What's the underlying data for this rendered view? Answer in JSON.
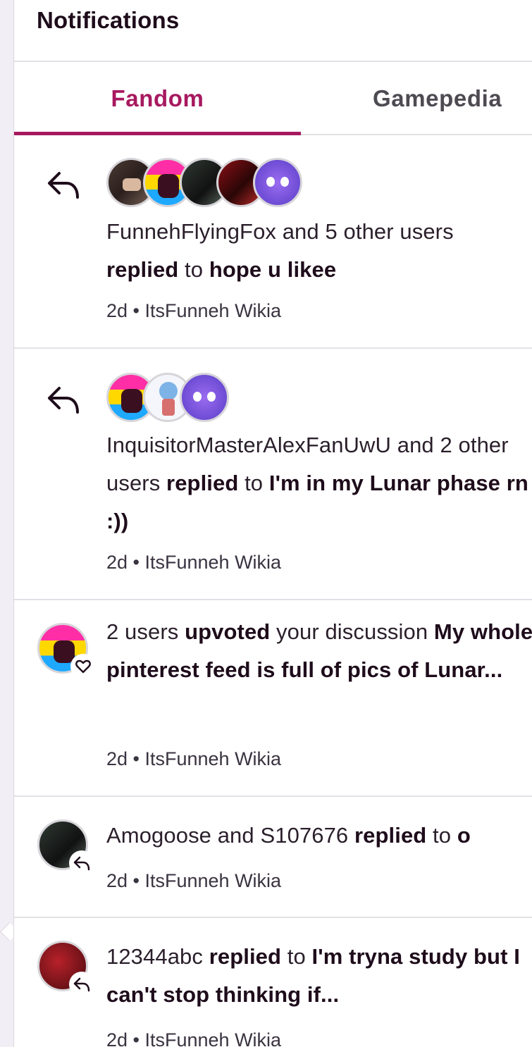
{
  "header": {
    "title": "Notifications"
  },
  "tabs": [
    {
      "label": "Fandom",
      "active": true
    },
    {
      "label": "Gamepedia",
      "active": false
    }
  ],
  "colors": {
    "accent": "#a7195f",
    "text": "#1e0c1b",
    "divider": "#e3e1e6"
  },
  "notifications": [
    {
      "icon": "reply-icon",
      "avatar_count": 5,
      "line1": "FunnehFlyingFox and 5 other users",
      "action": "replied",
      "to": " to ",
      "title": "hope u likee",
      "meta": "2d • ItsFunneh Wikia"
    },
    {
      "icon": "reply-icon",
      "avatar_count": 3,
      "line1": "InquisitorMasterAlexFanUwU and 2 other users ",
      "action": "replied",
      "to": " to ",
      "title": "I'm in my Lunar phase rn :))",
      "meta": "2d • ItsFunneh Wikia"
    },
    {
      "icon": "heart-icon",
      "pre": "2 users ",
      "action": "upvoted",
      "mid": " your discussion ",
      "title": "My whole pinterest feed is full of pics of Lunar...",
      "meta": "2d • ItsFunneh Wikia"
    },
    {
      "icon": "reply-icon",
      "pre": "Amogoose and S107676 ",
      "action": "replied",
      "to": " to ",
      "title": "o",
      "meta": "2d • ItsFunneh Wikia"
    },
    {
      "icon": "reply-icon",
      "pre": "12344abc ",
      "action": "replied",
      "to": " to ",
      "title": "I'm tryna study but I can't stop thinking if...",
      "meta": "2d • ItsFunneh Wikia"
    }
  ]
}
